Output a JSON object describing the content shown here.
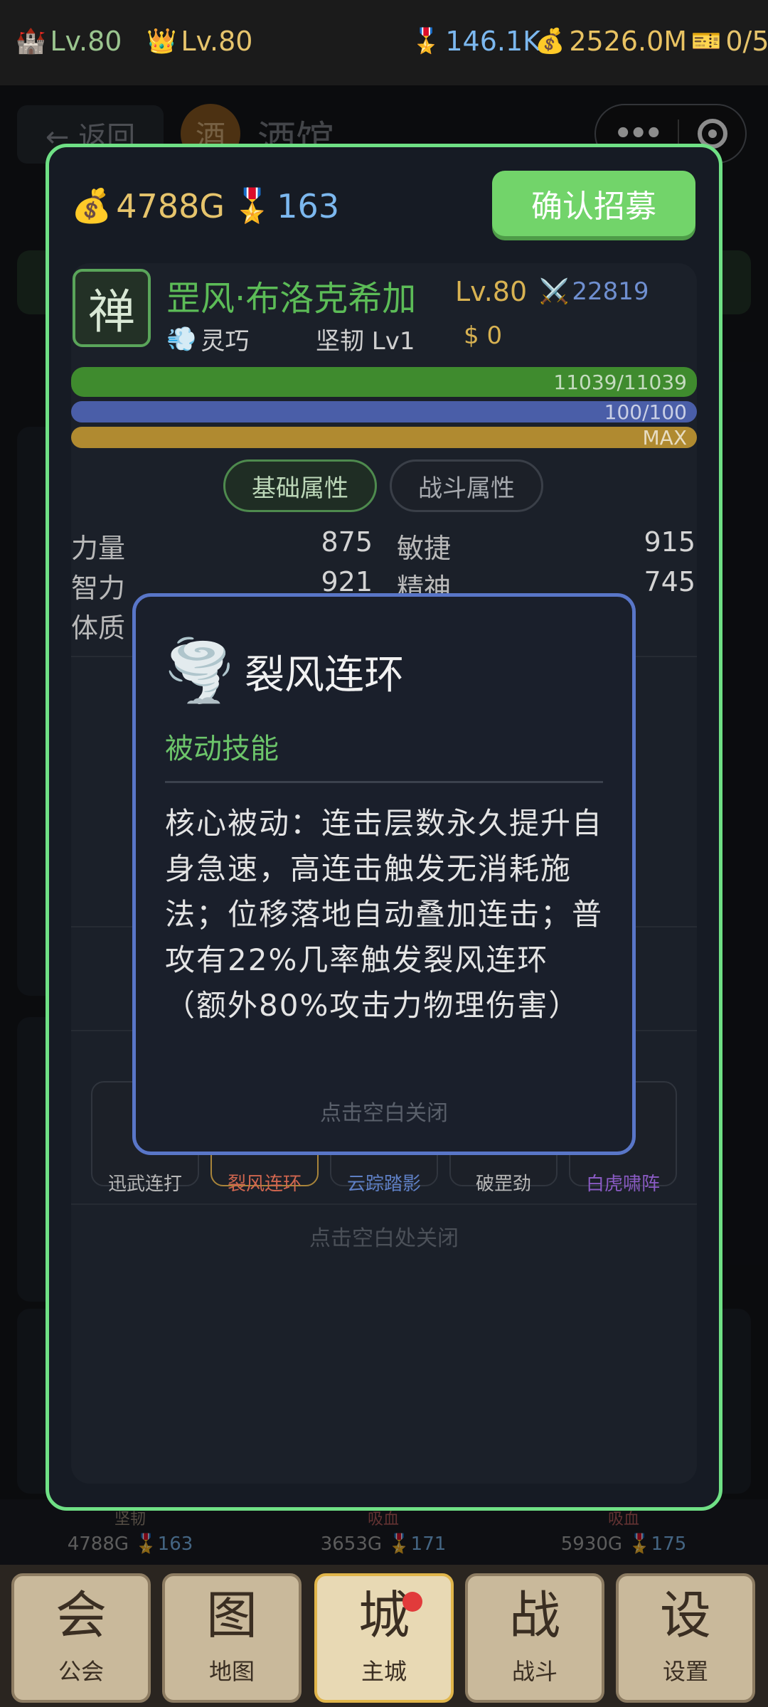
{
  "topbar": {
    "castle_level": "Lv.80",
    "crown_level": "Lv.80",
    "honor": "146.1K",
    "gold": "2526.0M",
    "tickets": "0/5"
  },
  "background": {
    "back_label": "← 返回",
    "title_badge": "酒",
    "title": "酒馆"
  },
  "recruit": {
    "gold": "4788G",
    "honor": "163",
    "confirm_label": "确认招募",
    "hero": {
      "avatar_char": "禅",
      "name": "罡风·布洛克希加",
      "level": "Lv.80",
      "power": "22819",
      "trait": "灵巧",
      "toughness": "坚韧 Lv1",
      "price": "$ 0",
      "hp_text": "11039/11039",
      "hp_ratio": 1.0,
      "mp_text": "100/100",
      "mp_ratio": 1.0,
      "exp_text": "MAX",
      "exp_ratio": 1.0
    },
    "tabs": {
      "basic": "基础属性",
      "battle": "战斗属性"
    },
    "stats": {
      "str_label": "力量",
      "str_val": "875",
      "agi_label": "敏捷",
      "agi_val": "915",
      "int_label": "智力",
      "int_val": "921",
      "spi_label": "精神",
      "spi_val": "745",
      "con_label": "体质"
    },
    "skills": [
      {
        "name": "迅武连打",
        "color": "#b7b7b7"
      },
      {
        "name": "裂风连环",
        "color": "#d1664f"
      },
      {
        "name": "云踪踏影",
        "color": "#5e7fc4"
      },
      {
        "name": "破罡劲",
        "color": "#b7b7b7"
      },
      {
        "name": "白虎啸阵",
        "color": "#8a5bc4"
      }
    ],
    "close_hint": "点击空白处关闭"
  },
  "tooltip": {
    "icon": "🌪️",
    "title": "裂风连环",
    "type": "被动技能",
    "description": "核心被动：连击层数永久提升自身急速，高连击触发无消耗施法；位移落地自动叠加连击；普攻有22%几率触发裂风连环（额外80%攻击力物理伤害）",
    "close_hint": "点击空白关闭"
  },
  "strip": [
    {
      "tag": "坚韧",
      "gold": "4788G",
      "honor": "163"
    },
    {
      "tag": "吸血",
      "gold": "3653G",
      "honor": "171"
    },
    {
      "tag": "吸血",
      "gold": "5930G",
      "honor": "175"
    }
  ],
  "nav": [
    {
      "glyph": "会",
      "label": "公会"
    },
    {
      "glyph": "图",
      "label": "地图"
    },
    {
      "glyph": "城",
      "label": "主城"
    },
    {
      "glyph": "战",
      "label": "战斗"
    },
    {
      "glyph": "设",
      "label": "设置"
    }
  ]
}
